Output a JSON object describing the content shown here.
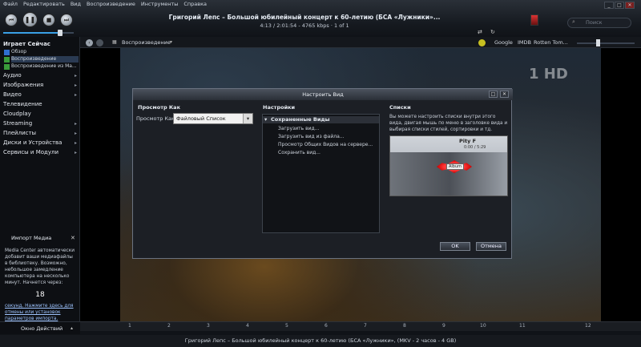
{
  "menu": [
    "Файл",
    "Редактировать",
    "Вид",
    "Воспроизведение",
    "Инструменты",
    "Справка"
  ],
  "player": {
    "title": "Григорий Лепс – Большой юбилейный концерт к 60-летию (БСА «Лужники»...",
    "info": "4:13 / 2:01:54 - 4765 kbps · 1 of 1",
    "search_placeholder": "Поиск"
  },
  "subbar": {
    "playback_label": "Воспроизведение",
    "links": [
      "Google",
      "IMDB",
      "Rotten Tom..."
    ]
  },
  "sidebar": {
    "playing_now": "Играет Сейчас",
    "playing_items": [
      "Обзор",
      "Воспроизведение",
      "Воспроизведение из Ma..."
    ],
    "sections": [
      "Аудио",
      "Изображения",
      "Видео",
      "Телевидение",
      "Cloudplay",
      "Streaming",
      "Плейлисты",
      "Диски и Устройства",
      "Сервисы и Модули"
    ],
    "import_title": "Импорт Медиа",
    "import_text": "Media Center автоматически добавит ваши медиафайлы в библиотеку. Возможно, небольшое замедление компьютера на несколько минут. Начнется через:",
    "import_count": "18",
    "import_link": "секунд. Нажмите здесь для отмены или установок параметров импорта.",
    "actions_label": "Окно Действий"
  },
  "dialog": {
    "title": "Настроить Вид",
    "view_as_header": "Просмотр Как",
    "view_as_label": "Просмотр Как:",
    "view_as_value": "Файловый Список",
    "settings_header": "Настройки",
    "saved_views": "Сохраненные Виды",
    "settings_items": [
      "Загрузить вид...",
      "Загрузить вид из файла...",
      "Просмотр Общих Видов на сервере...",
      "Сохранить вид..."
    ],
    "lists_header": "Списки",
    "lists_desc": "Вы можете настроить списки внутри этого вида, двигая мышь по меню в заголовке вида и выбирая списки стилей, сортировки и тд.",
    "preview_album": "Album",
    "preview_time": "0:00 / 5:29",
    "preview_top": "Pity F",
    "ok": "OK",
    "cancel": "Отмена"
  },
  "channel_logo": "1 HD",
  "timeline": [
    "1",
    "2",
    "3",
    "4",
    "5",
    "6",
    "7",
    "8",
    "9",
    "10",
    "11",
    "12"
  ],
  "status": "Григорий Лепс – Большой юбилейный концерт к 60-летию (БСА «Лужники», (MKV - 2 часов - 4 GB)"
}
